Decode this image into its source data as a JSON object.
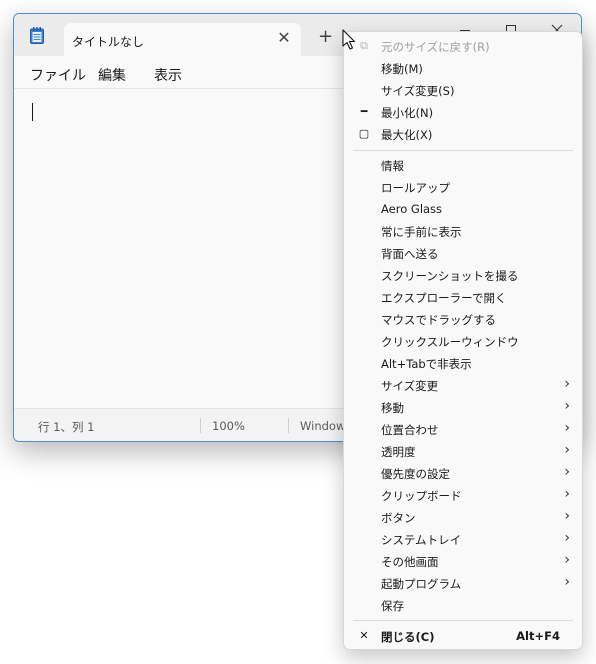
{
  "window": {
    "tab_title": "タイトルなし",
    "menu": [
      "ファイル",
      "編集",
      "表示"
    ],
    "status": {
      "position": "行 1、列 1",
      "zoom": "100%",
      "line_ending": "Window"
    }
  },
  "context_menu": {
    "items": [
      {
        "label": "元のサイズに戻す(R)",
        "icon": "restore-icon",
        "disabled": true
      },
      {
        "label": "移動(M)"
      },
      {
        "label": "サイズ変更(S)"
      },
      {
        "label": "最小化(N)",
        "icon": "minimize-icon"
      },
      {
        "label": "最大化(X)",
        "icon": "maximize-icon"
      },
      {
        "label": "情報"
      },
      {
        "label": "ロールアップ"
      },
      {
        "label": "Aero Glass"
      },
      {
        "label": "常に手前に表示"
      },
      {
        "label": "背面へ送る"
      },
      {
        "label": "スクリーンショットを撮る"
      },
      {
        "label": "エクスプローラーで開く"
      },
      {
        "label": "マウスでドラッグする"
      },
      {
        "label": "クリックスルーウィンドウ"
      },
      {
        "label": "Alt+Tabで非表示"
      },
      {
        "label": "サイズ変更",
        "submenu": true
      },
      {
        "label": "移動",
        "submenu": true
      },
      {
        "label": "位置合わせ",
        "submenu": true
      },
      {
        "label": "透明度",
        "submenu": true
      },
      {
        "label": "優先度の設定",
        "submenu": true
      },
      {
        "label": "クリップボード",
        "submenu": true
      },
      {
        "label": "ボタン",
        "submenu": true
      },
      {
        "label": "システムトレイ",
        "submenu": true
      },
      {
        "label": "その他画面",
        "submenu": true
      },
      {
        "label": "起動プログラム",
        "submenu": true
      },
      {
        "label": "保存"
      },
      {
        "label": "閉じる(C)",
        "shortcut": "Alt+F4",
        "icon": "close-icon",
        "bold": true
      }
    ]
  },
  "colors": {
    "window_border": "#4a8fd0",
    "app_icon": "#2f6db3",
    "menu_bg": "#f9f9f9"
  }
}
